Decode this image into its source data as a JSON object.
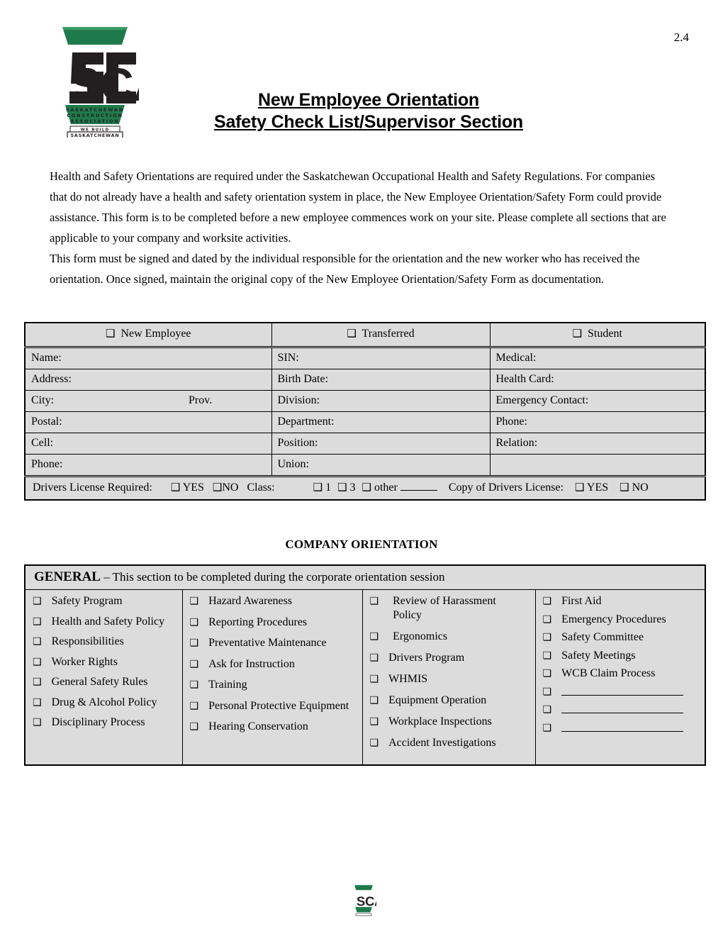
{
  "document": {
    "page_number": "2.4",
    "title_line1": "New Employee Orientation",
    "title_line2": "Safety Check List/Supervisor Section",
    "logo_alt": "SCA Saskatchewan Construction Association - We Build Saskatchewan"
  },
  "logo": {
    "acronym": "SCA",
    "line1": "SASKATCHEWAN",
    "line2": "CONSTRUCTION",
    "line3": "ASSOCIATION",
    "tag1": "WE BUILD",
    "tag2": "SASKATCHEWAN",
    "green": "#1e7a4a",
    "dark": "#231f20"
  },
  "intro": {
    "paragraph1": "Health and Safety Orientations are required under the Saskatchewan Occupational Health and Safety Regulations. For companies that do not already have a health and safety orientation system in place, the New Employee Orientation/Safety Form could provide assistance.  This form is to be completed before a new employee commences work on your site.  Please complete all sections that are applicable to your company and worksite activities.",
    "paragraph2": " This form must be signed and dated by the individual responsible for the orientation and the new worker who has received the orientation. Once signed, maintain the original copy of the New Employee Orientation/Safety Form as documentation."
  },
  "employee_table": {
    "type_options": [
      "New Employee",
      "Transferred",
      "Student"
    ],
    "rows": [
      {
        "c1": "Name:",
        "c2": "SIN:",
        "c3": "Medical:"
      },
      {
        "c1": "Address:",
        "c2": "Birth Date:",
        "c3": "Health Card:"
      },
      {
        "c1": "City:",
        "c1b": "Prov.",
        "c2": "Division:",
        "c3": "Emergency Contact:"
      },
      {
        "c1": "Postal:",
        "c2": "Department:",
        "c3": "Phone:"
      },
      {
        "c1": "Cell:",
        "c2": "Position:",
        "c3": "Relation:"
      },
      {
        "c1": "Phone:",
        "c2": "Union:",
        "c3": ""
      }
    ],
    "drivers_license": {
      "label": "Drivers License Required:",
      "yes": "YES",
      "no": "NO",
      "class_label": "Class:",
      "class_1": "1",
      "class_3": "3",
      "class_other": "other",
      "copy_label": "Copy of Drivers License:",
      "copy_yes": "YES",
      "copy_no": "NO"
    }
  },
  "company_orientation": {
    "heading": "COMPANY ORIENTATION",
    "general": {
      "title": "GENERAL",
      "subtitle": " – This section to be completed during the corporate orientation session",
      "column1": [
        "Safety Program",
        "Health and Safety Policy",
        "Responsibilities",
        "Worker Rights",
        "General Safety Rules",
        "Drug & Alcohol Policy",
        "Disciplinary Process"
      ],
      "column2": [
        "Hazard Awareness",
        "Reporting Procedures",
        "Preventative Maintenance",
        "Ask for Instruction",
        "Training",
        "Personal Protective Equipment",
        "Hearing Conservation"
      ],
      "column3": [
        "Review of Harassment Policy",
        "Ergonomics",
        "Drivers Program",
        "WHMIS",
        "Equipment Operation",
        "Workplace Inspections",
        "Accident Investigations"
      ],
      "column4": [
        "First Aid",
        "Emergency Procedures",
        "Safety Committee",
        "Safety Meetings",
        "WCB Claim Process",
        "",
        "",
        ""
      ]
    }
  },
  "icons": {
    "checkbox": "❑"
  },
  "colors": {
    "table_fill": "#dcdcdc",
    "border": "#000000",
    "brand_green": "#1e7a4a"
  }
}
